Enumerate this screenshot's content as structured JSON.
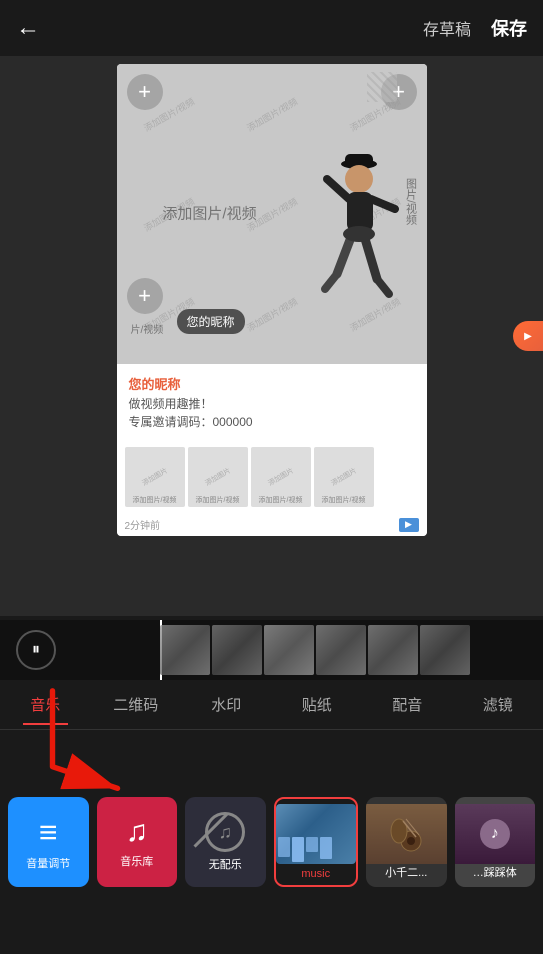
{
  "header": {
    "back_icon": "←",
    "draft_label": "存草稿",
    "save_label": "保存"
  },
  "preview": {
    "add_photo_label": "添加图片/视频",
    "nickname": "您的昵称",
    "desc_line1": "做视频用趣推！",
    "desc_line2": "专属邀请调码：000000",
    "time_label": "2分钟前",
    "watermark_text": "添加图片/视频"
  },
  "tabs": [
    {
      "id": "music",
      "label": "音乐",
      "active": true
    },
    {
      "id": "qrcode",
      "label": "二维码",
      "active": false
    },
    {
      "id": "watermark",
      "label": "水印",
      "active": false
    },
    {
      "id": "sticker",
      "label": "贴纸",
      "active": false
    },
    {
      "id": "dubbing",
      "label": "配音",
      "active": false
    },
    {
      "id": "filter",
      "label": "滤镜",
      "active": false
    }
  ],
  "tools": [
    {
      "id": "volume",
      "label": "音量调节",
      "icon": "≡",
      "type": "volume"
    },
    {
      "id": "music-lib",
      "label": "音乐库",
      "icon": "♪",
      "type": "music"
    },
    {
      "id": "no-music",
      "label": "无配乐",
      "icon": "⊗",
      "type": "no-music"
    },
    {
      "id": "music-selected",
      "label": "music",
      "icon": "",
      "type": "selected"
    },
    {
      "id": "guitar",
      "label": "小千二...",
      "icon": "",
      "type": "guitar"
    },
    {
      "id": "singer",
      "label": "…踩踩体",
      "icon": "",
      "type": "singer"
    }
  ],
  "colors": {
    "active_tab": "#f23e3e",
    "volume_bg": "#1e90ff",
    "music_bg": "#cc2244",
    "no_music_bg": "#2d2d3a",
    "selected_border": "#f23e3e",
    "background": "#1a1a1a"
  }
}
